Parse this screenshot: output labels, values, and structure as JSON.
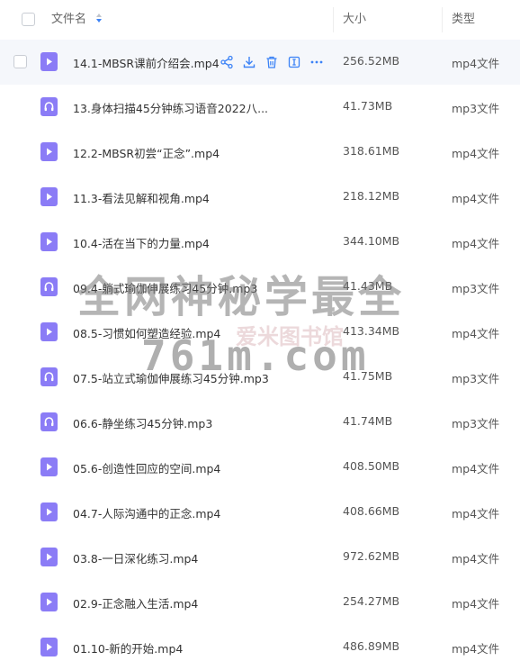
{
  "header": {
    "name_label": "文件名",
    "size_label": "大小",
    "type_label": "类型"
  },
  "files": [
    {
      "name": "14.1-MBSR课前介绍会.mp4",
      "size": "256.52MB",
      "type": "mp4文件",
      "kind": "video"
    },
    {
      "name": "13.身体扫描45分钟练习语音2022八...",
      "size": "41.73MB",
      "type": "mp3文件",
      "kind": "audio"
    },
    {
      "name": "12.2-MBSR初尝“正念”.mp4",
      "size": "318.61MB",
      "type": "mp4文件",
      "kind": "video"
    },
    {
      "name": "11.3-看法见解和视角.mp4",
      "size": "218.12MB",
      "type": "mp4文件",
      "kind": "video"
    },
    {
      "name": "10.4-活在当下的力量.mp4",
      "size": "344.10MB",
      "type": "mp4文件",
      "kind": "video"
    },
    {
      "name": "09.4-躺式瑜伽伸展练习45分钟.mp3",
      "size": "41.43MB",
      "type": "mp3文件",
      "kind": "audio"
    },
    {
      "name": "08.5-习惯如何塑造经验.mp4",
      "size": "413.34MB",
      "type": "mp4文件",
      "kind": "video"
    },
    {
      "name": "07.5-站立式瑜伽伸展练习45分钟.mp3",
      "size": "41.75MB",
      "type": "mp3文件",
      "kind": "audio"
    },
    {
      "name": "06.6-静坐练习45分钟.mp3",
      "size": "41.74MB",
      "type": "mp3文件",
      "kind": "audio"
    },
    {
      "name": "05.6-创造性回应的空间.mp4",
      "size": "408.50MB",
      "type": "mp4文件",
      "kind": "video"
    },
    {
      "name": "04.7-人际沟通中的正念.mp4",
      "size": "408.66MB",
      "type": "mp4文件",
      "kind": "video"
    },
    {
      "name": "03.8-一日深化练习.mp4",
      "size": "972.62MB",
      "type": "mp4文件",
      "kind": "video"
    },
    {
      "name": "02.9-正念融入生活.mp4",
      "size": "254.27MB",
      "type": "mp4文件",
      "kind": "video"
    },
    {
      "name": "01.10-新的开始.mp4",
      "size": "486.89MB",
      "type": "mp4文件",
      "kind": "video"
    }
  ],
  "row_actions": [
    "share-icon",
    "download-icon",
    "delete-icon",
    "rename-icon",
    "more-icon"
  ],
  "watermark": {
    "line1": "全网神秘学最全",
    "line2": "761m.com",
    "logo_text": "爱米图书馆"
  },
  "colors": {
    "file_icon": "#8b7cf6",
    "action_icon": "#3b82f6",
    "hover_row": "#f5f7fb"
  }
}
